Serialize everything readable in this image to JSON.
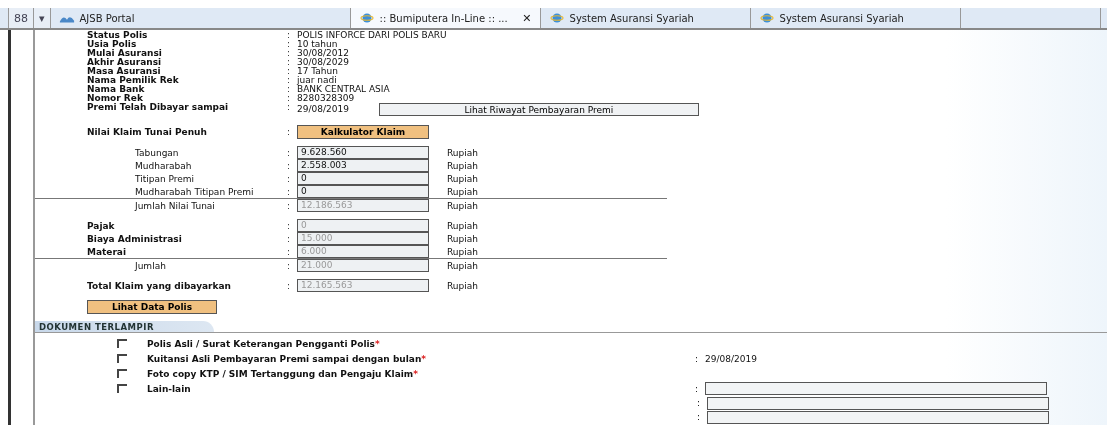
{
  "toolbar": {
    "grid_button": "88",
    "dropdown": "▾"
  },
  "tabs": [
    {
      "label": "AJSB Portal",
      "kind": "portal",
      "selected": false
    },
    {
      "label": ":: Bumiputera In-Line :: ...",
      "kind": "browser",
      "selected": true,
      "close": "✕"
    },
    {
      "label": "System Asuransi Syariah",
      "kind": "browser",
      "selected": false
    },
    {
      "label": "System Asuransi Syariah",
      "kind": "browser",
      "selected": false
    }
  ],
  "info": [
    {
      "label": "Status Polis",
      "colon": ":",
      "value": "POLIS INFORCE DARI POLIS BARU"
    },
    {
      "label": "Usia Polis",
      "colon": ":",
      "value": "10 tahun"
    },
    {
      "label": "Mulai Asuransi",
      "colon": ":",
      "value": "30/08/2012"
    },
    {
      "label": "Akhir Asuransi",
      "colon": ":",
      "value": "30/08/2029"
    },
    {
      "label": "Masa Asuransi",
      "colon": ":",
      "value": "17 Tahun"
    },
    {
      "label": "Nama Pemilik Rek",
      "colon": ":",
      "value": "juar nadi"
    },
    {
      "label": "Nama Bank",
      "colon": ":",
      "value": "BANK CENTRAL ASIA"
    },
    {
      "label": "Nomor Rek",
      "colon": ":",
      "value": "8280328309"
    },
    {
      "label": "Premi Telah Dibayar sampai",
      "colon": ":",
      "value": "29/08/2019"
    }
  ],
  "riwayat_button": "Lihat Riwayat Pembayaran Premi",
  "nilai_klaim": {
    "label": "Nilai Klaim Tunai Penuh",
    "colon": ":",
    "button": "Kalkulator Klaim"
  },
  "amount_groups": [
    {
      "rows": [
        {
          "label": "Tabungan",
          "colon": ":",
          "value": "9.628.560",
          "unit": "Rupiah",
          "kind": "sub",
          "disabled": false
        },
        {
          "label": "Mudharabah",
          "colon": ":",
          "value": "2.558.003",
          "unit": "Rupiah",
          "kind": "sub",
          "disabled": false
        },
        {
          "label": "Titipan Premi",
          "colon": ":",
          "value": "0",
          "unit": "Rupiah",
          "kind": "sub",
          "disabled": false
        },
        {
          "label": "Mudharabah Titipan Premi",
          "colon": ":",
          "value": "0",
          "unit": "Rupiah",
          "kind": "sub",
          "disabled": false
        },
        {
          "label": "Jumlah Nilai Tunai",
          "colon": ":",
          "value": "12.186.563",
          "unit": "Rupiah",
          "kind": "total",
          "disabled": true
        }
      ]
    },
    {
      "rows": [
        {
          "label": "Pajak",
          "colon": ":",
          "value": "0",
          "unit": "Rupiah",
          "kind": "main",
          "disabled": true
        },
        {
          "label": "Biaya Administrasi",
          "colon": ":",
          "value": "15.000",
          "unit": "Rupiah",
          "kind": "main",
          "disabled": true
        },
        {
          "label": "Materai",
          "colon": ":",
          "value": "6.000",
          "unit": "Rupiah",
          "kind": "main",
          "disabled": true
        },
        {
          "label": "Jumlah",
          "colon": ":",
          "value": "21.000",
          "unit": "Rupiah",
          "kind": "total",
          "disabled": true
        }
      ]
    },
    {
      "rows": [
        {
          "label": "Total Klaim yang dibayarkan",
          "colon": ":",
          "value": "12.165.563",
          "unit": "Rupiah",
          "kind": "main",
          "disabled": true
        }
      ]
    }
  ],
  "data_polis_button": "Lihat Data Polis",
  "section_title": "DOKUMEN TERLAMPIR",
  "documents": [
    {
      "label": "Polis Asli / Surat Keterangan Pengganti Polis",
      "required_mark": "*",
      "checked": false
    },
    {
      "label": "Kuitansi Asli Pembayaran Premi sampai dengan bulan",
      "required_mark": "*",
      "checked": false,
      "colon": ":",
      "value": "29/08/2019"
    },
    {
      "label": "Foto copy KTP / SIM Tertanggung dan Pengaju Klaim",
      "required_mark": "*",
      "checked": false
    },
    {
      "label": "Lain-lain",
      "checked": false,
      "inputs": [
        {
          "colon": ":"
        },
        {
          "colon": ":"
        },
        {
          "colon": ":"
        }
      ]
    }
  ]
}
